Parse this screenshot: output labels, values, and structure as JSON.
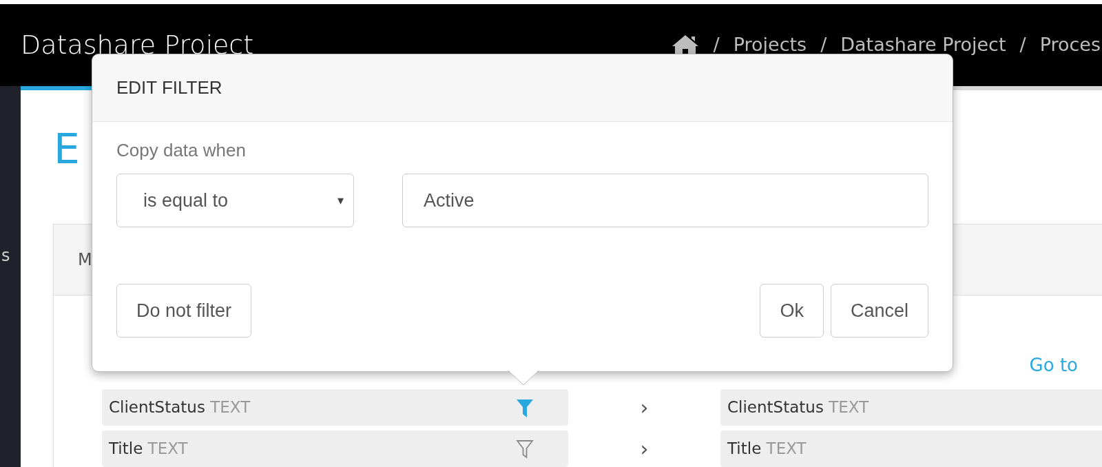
{
  "header": {
    "title": "Datashare Project",
    "breadcrumb": [
      {
        "separator": "/",
        "label": "Projects"
      },
      {
        "separator": "/",
        "label": "Datashare Project"
      },
      {
        "separator": "/",
        "label": "Proces"
      }
    ]
  },
  "sidebar": {
    "items": [
      "s"
    ]
  },
  "page": {
    "heading": "E",
    "card_tab": "M",
    "link": "Go to"
  },
  "mappings": [
    {
      "source": "ClientStatus",
      "source_type": "TEXT",
      "filtered": true,
      "arrow": "›",
      "target": "ClientStatus",
      "target_type": "TEXT"
    },
    {
      "source": "Title",
      "source_type": "TEXT",
      "filtered": false,
      "arrow": "›",
      "target": "Title",
      "target_type": "TEXT"
    }
  ],
  "modal": {
    "title": "EDIT FILTER",
    "label": "Copy data when",
    "operator": "is equal to",
    "caret": "▾",
    "value": "Active",
    "buttons": [
      {
        "kind": "left",
        "label": "Do not filter"
      },
      {
        "kind": "right",
        "label": "Ok"
      },
      {
        "kind": "right",
        "label": "Cancel"
      }
    ]
  }
}
